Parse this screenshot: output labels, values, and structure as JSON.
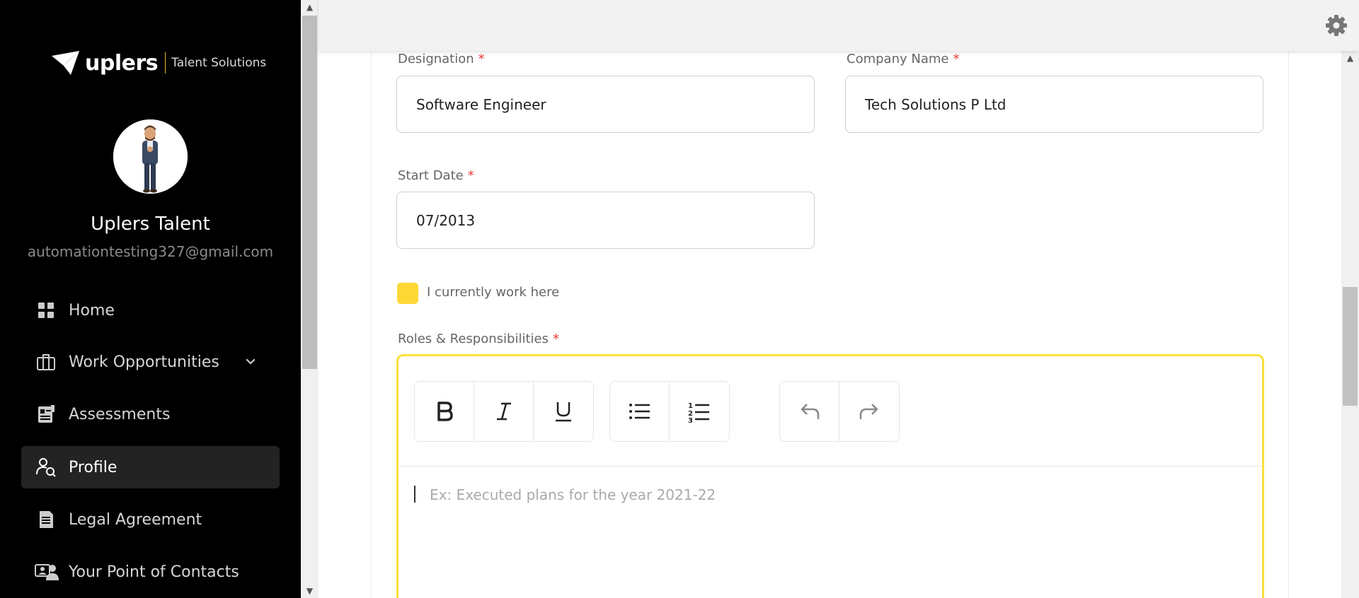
{
  "brand": {
    "name": "uplers",
    "tagline": "Talent Solutions"
  },
  "user": {
    "name": "Uplers Talent",
    "email": "automationtesting327@gmail.com"
  },
  "nav": [
    {
      "label": "Home",
      "icon": "grid-icon",
      "active": false
    },
    {
      "label": "Work Opportunities",
      "icon": "briefcase-icon",
      "active": false,
      "has_submenu": true
    },
    {
      "label": "Assessments",
      "icon": "assessment-icon",
      "active": false
    },
    {
      "label": "Profile",
      "icon": "profile-search-icon",
      "active": true
    },
    {
      "label": "Legal Agreement",
      "icon": "document-icon",
      "active": false
    },
    {
      "label": "Your Point of Contacts",
      "icon": "contacts-icon",
      "active": false
    }
  ],
  "form": {
    "designation": {
      "label": "Designation",
      "value": "Software Engineer",
      "required": "*"
    },
    "company": {
      "label": "Company Name",
      "value": "Tech Solutions P Ltd",
      "required": "*"
    },
    "start_date": {
      "label": "Start Date",
      "value": "07/2013",
      "required": "*"
    },
    "current": {
      "label": "I currently work here",
      "checked": true
    },
    "roles": {
      "label": "Roles & Responsibilities",
      "required": "*",
      "placeholder": "Ex: Executed plans for the year 2021-22"
    }
  },
  "toolbar": {
    "format": [
      "bold-icon",
      "italic-icon",
      "underline-icon"
    ],
    "lists": [
      "bullet-list-icon",
      "numbered-list-icon"
    ],
    "history": [
      "undo-icon",
      "redo-icon"
    ]
  },
  "colors": {
    "accent": "#fdd835",
    "sidebar": "#000000",
    "required": "#e53935"
  }
}
